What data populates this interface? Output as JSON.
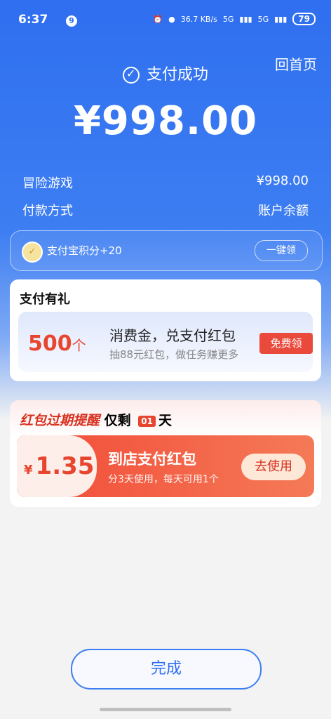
{
  "status_bar": {
    "time": "6:37",
    "badge": "9",
    "net_speed": "36.7 KB/s",
    "signal1": "5G",
    "signal2": "5G",
    "battery": "79"
  },
  "header": {
    "home_link": "回首页",
    "title": "支付成功",
    "amount": "¥998.00"
  },
  "details": [
    {
      "label": "冒险游戏",
      "value": "¥998.00"
    },
    {
      "label": "付款方式",
      "value": "账户余额"
    }
  ],
  "points": {
    "text": "支付宝积分+20",
    "button": "一键领"
  },
  "gift": {
    "header": "支付有礼",
    "count": "500",
    "unit": "个",
    "title": "消费金，兑支付红包",
    "subtitle": "抽88元红包，做任务赚更多",
    "button": "免费领"
  },
  "expire": {
    "title_red": "红包过期提醒",
    "title_rest": "仅剩",
    "days": "01",
    "days_unit": "天",
    "currency": "¥",
    "amount": "1.35",
    "name": "到店支付红包",
    "desc": "分3天使用，每天可用1个",
    "button": "去使用"
  },
  "done_button": "完成",
  "colors": {
    "brand_blue": "#2f6ff0",
    "accent_red": "#e8452f"
  }
}
